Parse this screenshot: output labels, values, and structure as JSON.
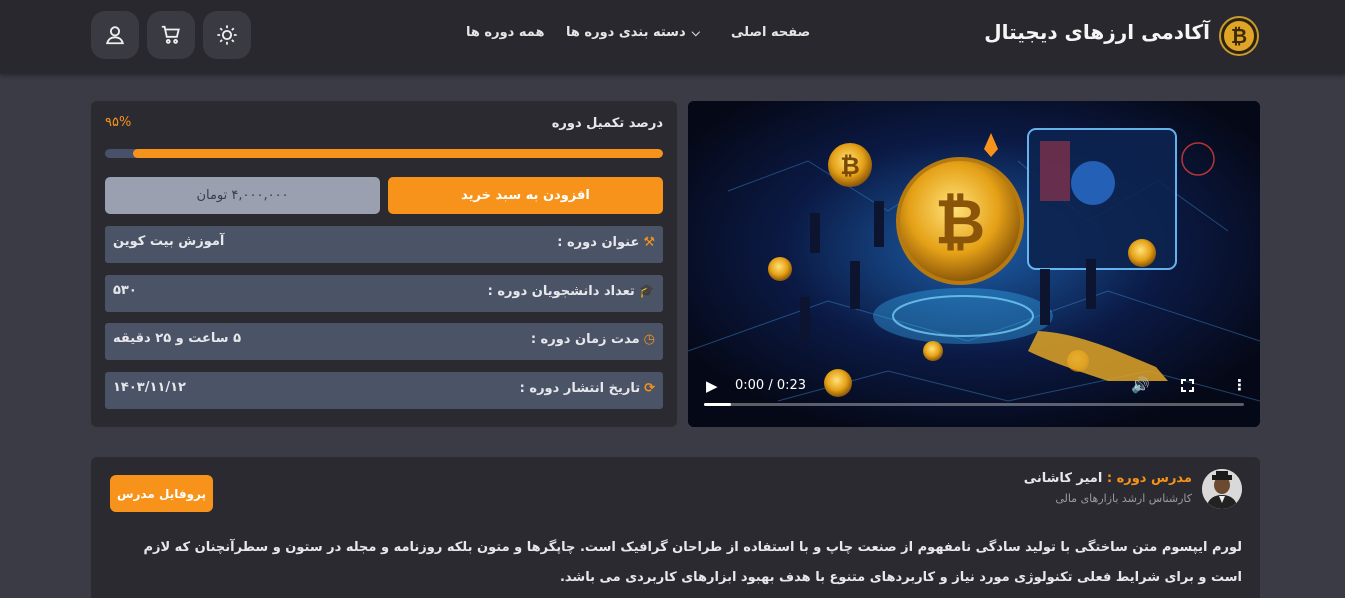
{
  "header": {
    "brand": "آکادمی ارزهای دیجیتال",
    "nav": {
      "home": "صفحه اصلی",
      "categories": "دسته بندی دوره ها",
      "all_courses": "همه دوره ها"
    },
    "icons": [
      "user-icon",
      "cart-icon",
      "sun-icon"
    ]
  },
  "course": {
    "progress_label": "درصد تکمیل دوره",
    "progress_pct_text": "۹۵%",
    "progress_value": 0.95,
    "add_to_cart": "افزودن به سبد خرید",
    "price": "۴,۰۰۰,۰۰۰ تومان",
    "rows": [
      {
        "label": "عنوان دوره :",
        "value": "آموزش بیت کوین",
        "icon": "hammer-icon"
      },
      {
        "label": "تعداد دانشجویان دوره :",
        "value": "۵۳۰",
        "icon": "graduation-cap-icon"
      },
      {
        "label": "مدت زمان دوره :",
        "value": "۵ ساعت و ۲۵ دقیقه",
        "icon": "clock-icon"
      },
      {
        "label": "تاریخ انتشار دوره :",
        "value": "۱۴۰۳/۱۱/۱۲",
        "icon": "refresh-icon"
      }
    ]
  },
  "video": {
    "time": "0:00 / 0:23",
    "played_fraction": 0.05
  },
  "teacher": {
    "role": "مدرس دوره :",
    "name": "امیر کاشانی",
    "title": "کارشناس ارشد بازارهای مالی",
    "profile_button": "پروفایل مدرس",
    "description": "لورم ایپسوم متن ساختگی با تولید سادگی نامفهوم از صنعت چاپ و با استفاده از طراحان گرافیک است. چاپگرها و متون بلکه روزنامه و مجله در ستون و سطرآنچنان که لازم است و برای شرایط فعلی تکنولوژی مورد نیاز و کاربردهای متنوع با هدف بهبود ابزارهای کاربردی می باشد."
  },
  "colors": {
    "accent": "#f7931a",
    "header_bg": "#28282e",
    "page_bg": "#3b3b45",
    "card_bg": "#2a2a30",
    "row_bg": "#4a5466"
  }
}
